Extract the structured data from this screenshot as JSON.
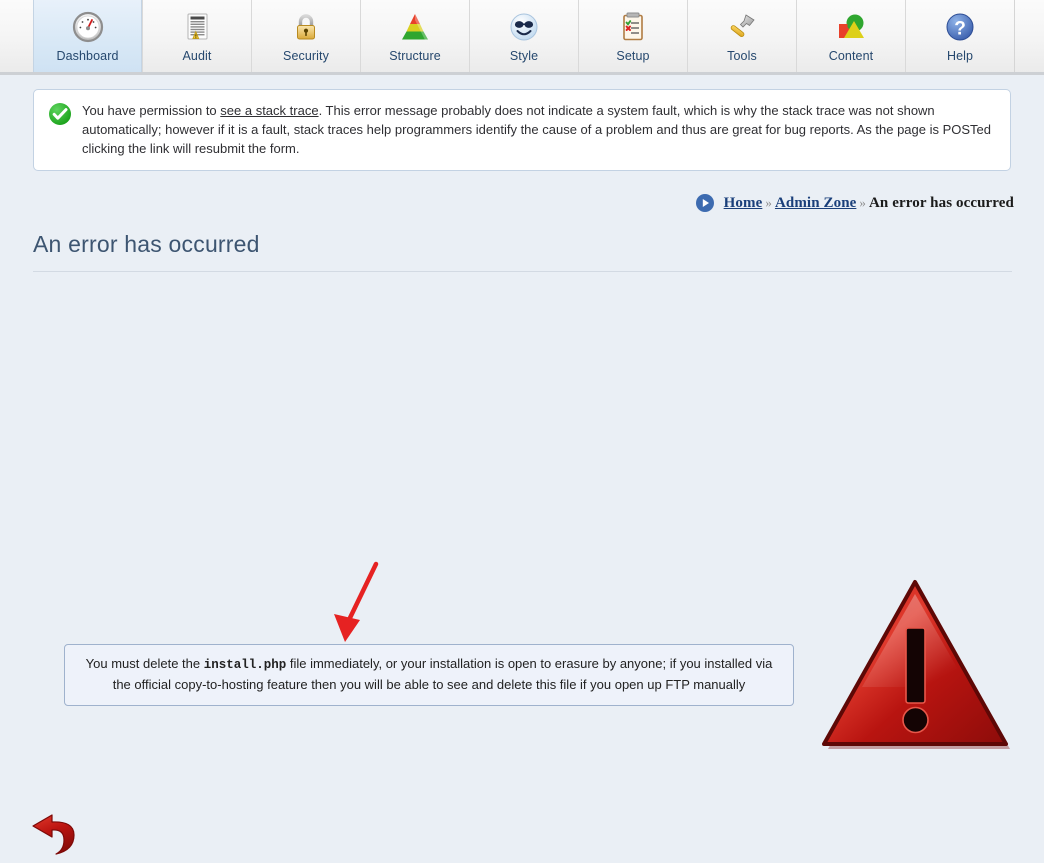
{
  "tabs": [
    {
      "label": "Dashboard",
      "icon": "gauge-icon",
      "active": true
    },
    {
      "label": "Audit",
      "icon": "document-warning-icon",
      "active": false
    },
    {
      "label": "Security",
      "icon": "padlock-icon",
      "active": false
    },
    {
      "label": "Structure",
      "icon": "pyramid-icon",
      "active": false
    },
    {
      "label": "Style",
      "icon": "sunglasses-smiley-icon",
      "active": false
    },
    {
      "label": "Setup",
      "icon": "clipboard-checklist-icon",
      "active": false
    },
    {
      "label": "Tools",
      "icon": "hammer-icon",
      "active": false
    },
    {
      "label": "Content",
      "icon": "shapes-icon",
      "active": false
    },
    {
      "label": "Help",
      "icon": "question-mark-icon",
      "active": false
    }
  ],
  "notice": {
    "icon": "green-check-icon",
    "text_before_link": "You have permission to ",
    "link_text": "see a stack trace",
    "text_after_link": ". This error message probably does not indicate a system fault, which is why the stack trace was not shown automatically; however if it is a fault, stack traces help programmers identify the cause of a problem and thus are great for bug reports. As the page is POSTed clicking the link will resubmit the form."
  },
  "breadcrumb": {
    "icon": "play-circle-icon",
    "items": [
      {
        "label": "Home",
        "link": true
      },
      {
        "label": "Admin Zone",
        "link": true
      },
      {
        "label": "An error has occurred",
        "link": false
      }
    ],
    "separator": "»"
  },
  "page": {
    "title": "An error has occurred"
  },
  "error_message": {
    "part1": "You must delete the ",
    "filename": "install.php",
    "part2": " file immediately, or your installation is open to erasure by anyone; if you installed via the official copy-to-hosting feature then you will be able to see and delete this file if you open up FTP manually"
  },
  "icons": {
    "warning_triangle": "red-warning-triangle-icon",
    "back_arrow": "red-back-arrow-icon",
    "annotation_arrow": "red-annotation-arrow"
  },
  "colors": {
    "page_background": "#eaeff5",
    "accent_link": "#1a3f7a",
    "title_text": "#3d5571",
    "success_green": "#20a020",
    "warning_red": "#cc1111",
    "active_tab": "#d8e8f6"
  }
}
